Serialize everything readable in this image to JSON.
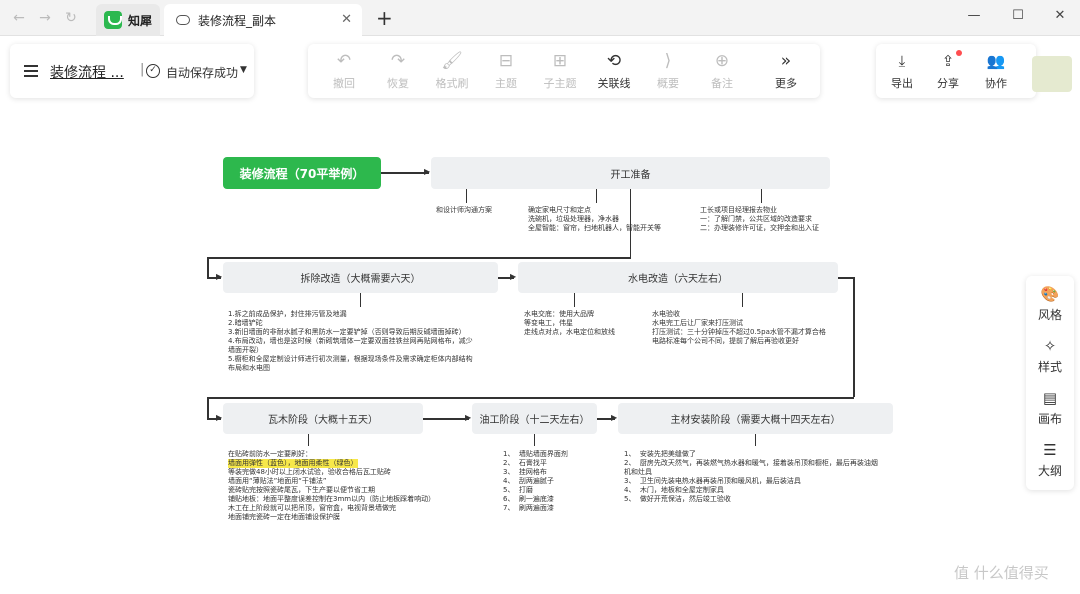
{
  "tabs": {
    "app_name": "知犀",
    "doc_tab_title": "装修流程_副本",
    "new_tab": "+",
    "close": "✕"
  },
  "nav": {
    "back": "←",
    "forward": "→",
    "reload": "↻"
  },
  "window": {
    "minimize": "—",
    "maximize": "☐",
    "close": "✕"
  },
  "doc": {
    "title": "装修流程 ...",
    "separator": "|",
    "save_status": "自动保存成功",
    "save_icon": "✓",
    "caret": "▼"
  },
  "toolbar": [
    {
      "label": "撤回",
      "icon": "↶"
    },
    {
      "label": "恢复",
      "icon": "↷"
    },
    {
      "label": "格式刷",
      "icon": "🖌"
    },
    {
      "label": "主题",
      "icon": "⊟"
    },
    {
      "label": "子主题",
      "icon": "⊞"
    },
    {
      "label": "关联线",
      "icon": "⟲"
    },
    {
      "label": "概要",
      "icon": "⟩"
    },
    {
      "label": "备注",
      "icon": "⊕"
    },
    {
      "label": "更多",
      "icon": "»"
    }
  ],
  "actions": [
    {
      "label": "导出",
      "icon": "⤓"
    },
    {
      "label": "分享",
      "icon": "⇪"
    },
    {
      "label": "协作",
      "icon": "👥"
    }
  ],
  "mindmap": {
    "root": "装修流程（70平举例）",
    "stage1": "开工准备",
    "stage1_notes": [
      "和设计师沟通方案",
      "确定家电尺寸和定点\n洗碗机，垃圾处理器，净水器\n全屋智能：窗帘，扫地机器人，智能开关等",
      "工长或项目经理报去物业\n一：了解门禁，公共区域的改造要求\n二：办理装修许可证，交押金和出入证"
    ],
    "stage2": "拆除改造（大概需要六天）",
    "stage2_notes": "1.拆之前成品保护，封住排污管及地漏\n2.暗墙铲砣\n3.新旧墙面的非耐水腻子和黑防水一定要铲掉（否则导致后期反碱墙面掉砖）\n4.布局改动，墙也是这时候（新砌筑墙体一定要双面挂铁丝网再贴网格布，减少\n墙面开裂）\n5.橱柜和全屋定制设计师进行初次测量，根据现场条件及需求确定柜体内部结构\n布局和水电图",
    "stage3": "水电改造（六天左右）",
    "stage3_notes": [
      "水电交底：使用大品牌\n等变电工，伟星\n走线点对点，水电定位和放线",
      "水电验收\n水电完工后让厂家来打压测试\n打压测试：三十分钟掉压不超过0.5pa水管不漏才算合格\n电路标准每个公司不同，提前了解后再验收更好"
    ],
    "stage4": "瓦木阶段（大概十五天）",
    "stage4_notes_intro": "在贴砖前防水一定要刷好：",
    "stage4_notes_hl": "墙面用弹性（蓝色），地面用柔性（绿色）",
    "stage4_notes": "等装完做48小时以上闭水试验，验收合格后瓦工贴砖\n墙面用“薄贴法”地面用“干铺法”\n瓷砖贴完按照瓷砖尾瓦，下生产要以便节省工期\n铺贴地板：地面平整度误差控制在3mm以内（防止地板踩着响动）\n木工在上阶段就可以把吊顶，窗帘盒，电视背景墙做完\n地面铺完瓷砖一定在地面铺设保护膜",
    "stage5": "油工阶段（十二天左右）",
    "stage5_notes": "1、  墙贴墙面界面剂\n2、  石膏找平\n3、  挂网格布\n4、  刮两遍腻子\n5、  打磨\n6、  刷一遍底漆\n7、  刷两遍面漆",
    "stage6": "主材安装阶段（需要大概十四天左右）",
    "stage6_notes": "1、  安装先把美缝做了\n2、  厨房先改天然气，再装燃气热水器和暖气，接着装吊顶和橱柜，最后再装油烟\n机和灶具\n3、  卫生间先装电热水器再装吊顶和暖风机，最后装洁具\n4、  木门，地板和全屋定制家具\n5、  做好开荒保洁，然后竣工验收"
  },
  "side_panel": [
    {
      "label": "风格",
      "icon": "🎨"
    },
    {
      "label": "样式",
      "icon": "✧"
    },
    {
      "label": "画布",
      "icon": "▤"
    },
    {
      "label": "大纲",
      "icon": "☰"
    }
  ],
  "watermark": "值 什么值得买"
}
